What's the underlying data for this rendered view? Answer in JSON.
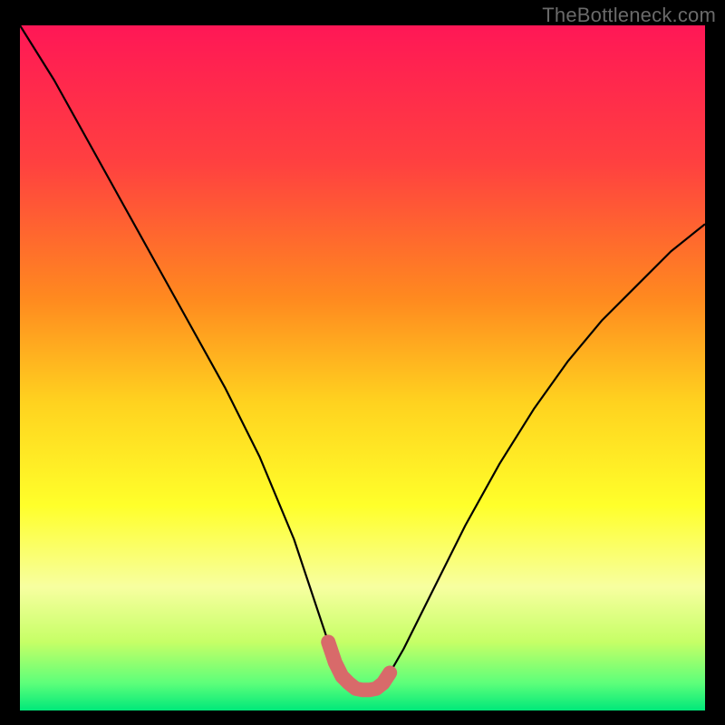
{
  "watermark": "TheBottleneck.com",
  "chart_data": {
    "type": "line",
    "title": "",
    "xlabel": "",
    "ylabel": "",
    "xlim": [
      0,
      100
    ],
    "ylim": [
      0,
      100
    ],
    "series": [
      {
        "name": "bottleneck-curve",
        "x": [
          0,
          5,
          10,
          15,
          20,
          25,
          30,
          35,
          40,
          42,
          44,
          45,
          46,
          47,
          48,
          49,
          50,
          51,
          52,
          53,
          54,
          56,
          58,
          60,
          65,
          70,
          75,
          80,
          85,
          90,
          95,
          100
        ],
        "values": [
          100,
          92,
          83,
          74,
          65,
          56,
          47,
          37,
          25,
          19,
          13,
          10,
          7,
          5,
          4,
          3.2,
          3,
          3,
          3.2,
          4,
          5.5,
          9,
          13,
          17,
          27,
          36,
          44,
          51,
          57,
          62,
          67,
          71
        ]
      }
    ],
    "highlight": {
      "name": "minimum-region",
      "x_range": [
        45,
        54
      ],
      "y_approx": 3.5,
      "color": "#d86a6a"
    },
    "background_gradient": {
      "stops": [
        {
          "offset": 0.0,
          "color": "#ff1756"
        },
        {
          "offset": 0.2,
          "color": "#ff4040"
        },
        {
          "offset": 0.4,
          "color": "#ff8a1f"
        },
        {
          "offset": 0.55,
          "color": "#ffd21f"
        },
        {
          "offset": 0.7,
          "color": "#ffff2a"
        },
        {
          "offset": 0.82,
          "color": "#f7ffa0"
        },
        {
          "offset": 0.9,
          "color": "#c6ff66"
        },
        {
          "offset": 0.96,
          "color": "#5dff7a"
        },
        {
          "offset": 1.0,
          "color": "#00e87a"
        }
      ]
    }
  }
}
